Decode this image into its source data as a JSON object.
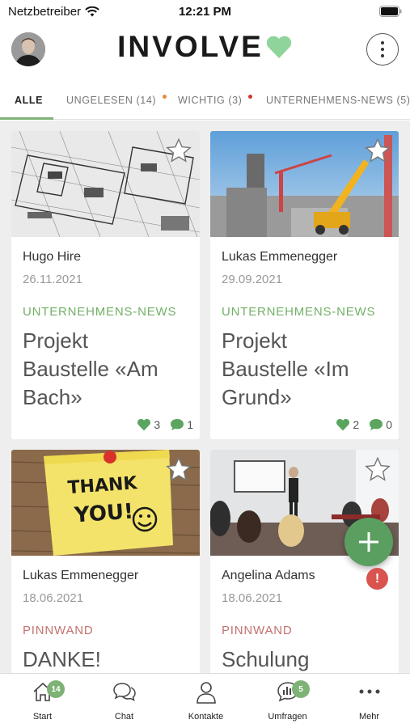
{
  "status_bar": {
    "carrier": "Netzbetreiber",
    "time": "12:21 PM"
  },
  "header": {
    "logo_text": "INVOLVE"
  },
  "tabs": [
    {
      "label": "ALLE",
      "count": "",
      "dot_color": ""
    },
    {
      "label": "UNGELESEN",
      "count": "(14)",
      "dot_color": "#e8893b"
    },
    {
      "label": "WICHTIG",
      "count": "(3)",
      "dot_color": "#d0342c"
    },
    {
      "label": "UNTERNEHMENS-NEWS",
      "count": "(5)",
      "dot_color": "#7db375"
    }
  ],
  "colors": {
    "accent": "#7db375",
    "news": "#72b067",
    "pinnwand": "#c47270",
    "fab": "#5a9f5f",
    "alert": "#d9534f"
  },
  "cards": [
    {
      "image": "blueprint",
      "author": "Hugo Hire",
      "date": "26.11.2021",
      "category": "UNTERNEHMENS-NEWS",
      "category_type": "news",
      "title_lines": [
        "Projekt",
        "Baustelle «Am",
        "Bach»"
      ],
      "likes": "3",
      "comments": "1"
    },
    {
      "image": "construction",
      "author": "Lukas Emmenegger",
      "date": "29.09.2021",
      "category": "UNTERNEHMENS-NEWS",
      "category_type": "news",
      "title_lines": [
        "Projekt",
        "Baustelle «Im",
        "Grund»"
      ],
      "likes": "2",
      "comments": "0"
    },
    {
      "image": "sticky-note",
      "image_text": [
        "THANK",
        "YOU!"
      ],
      "author": "Lukas Emmenegger",
      "date": "18.06.2021",
      "category": "PINNWAND",
      "category_type": "pinnwand",
      "title_lines": [
        "DANKE!"
      ]
    },
    {
      "image": "training-room",
      "author": "Angelina Adams",
      "date": "18.06.2021",
      "category": "PINNWAND",
      "category_type": "pinnwand",
      "title_lines": [
        "Schulung"
      ]
    }
  ],
  "alert_badge": "!",
  "bottom_nav": [
    {
      "label": "Start",
      "icon": "home-icon",
      "badge": "14"
    },
    {
      "label": "Chat",
      "icon": "chat-icon",
      "badge": ""
    },
    {
      "label": "Kontakte",
      "icon": "person-icon",
      "badge": ""
    },
    {
      "label": "Umfragen",
      "icon": "poll-icon",
      "badge": "5"
    },
    {
      "label": "Mehr",
      "icon": "more-dots-icon",
      "badge": ""
    }
  ]
}
